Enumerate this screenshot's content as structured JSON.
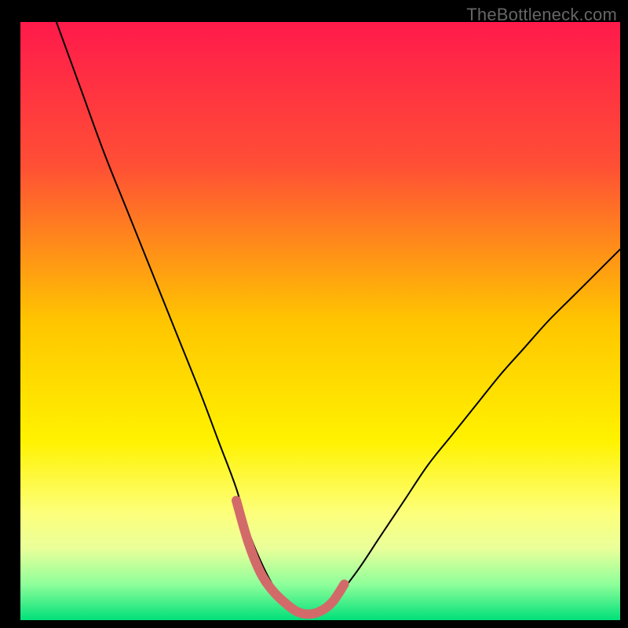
{
  "watermark": "TheBottleneck.com",
  "chart_data": {
    "type": "line",
    "title": "",
    "xlabel": "",
    "ylabel": "",
    "xlim": [
      0,
      100
    ],
    "ylim": [
      0,
      100
    ],
    "gradient_stops": [
      {
        "offset": 0,
        "color": "#ff1a4b"
      },
      {
        "offset": 24,
        "color": "#ff4f35"
      },
      {
        "offset": 50,
        "color": "#ffc500"
      },
      {
        "offset": 70,
        "color": "#fff200"
      },
      {
        "offset": 82,
        "color": "#fdff7a"
      },
      {
        "offset": 88,
        "color": "#eaff9a"
      },
      {
        "offset": 94,
        "color": "#8fff9a"
      },
      {
        "offset": 100,
        "color": "#00e07a"
      }
    ],
    "series": [
      {
        "name": "bottleneck-curve",
        "stroke": "#000000",
        "x": [
          6,
          10,
          14,
          18,
          22,
          26,
          30,
          33,
          36,
          38,
          40,
          42,
          44,
          46,
          48,
          50,
          52,
          56,
          60,
          64,
          68,
          72,
          76,
          80,
          84,
          88,
          92,
          96,
          100
        ],
        "values": [
          100,
          89,
          78,
          68,
          58,
          48,
          38,
          30,
          22,
          15,
          10,
          6,
          3,
          1.5,
          1,
          1.5,
          3,
          8,
          14,
          20,
          26,
          31,
          36,
          41,
          45.5,
          50,
          54,
          58,
          62
        ]
      },
      {
        "name": "highlight-region",
        "stroke": "#d36a6a",
        "x": [
          36,
          38,
          40,
          42,
          44,
          46,
          48,
          50,
          52,
          54
        ],
        "values": [
          20,
          13,
          8,
          5,
          3,
          1.5,
          1,
          1.5,
          3,
          6
        ]
      }
    ]
  }
}
